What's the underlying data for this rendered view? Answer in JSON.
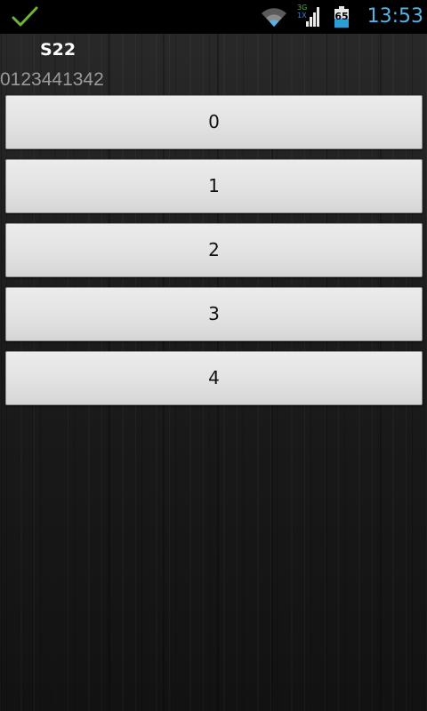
{
  "status_bar": {
    "network_type": "3G",
    "network_sub": "1X",
    "battery_level": "65",
    "time": "13:53",
    "icons": [
      "check-icon",
      "wifi-icon",
      "signal-icon",
      "battery-icon"
    ],
    "colors": {
      "check": "#6fb43a",
      "clock": "#54b4e6",
      "battery": "#2a9fd6"
    }
  },
  "header": {
    "title": "S22",
    "subtitle": "0123441342"
  },
  "options": [
    {
      "label": "0"
    },
    {
      "label": "1"
    },
    {
      "label": "2"
    },
    {
      "label": "3"
    },
    {
      "label": "4"
    }
  ]
}
